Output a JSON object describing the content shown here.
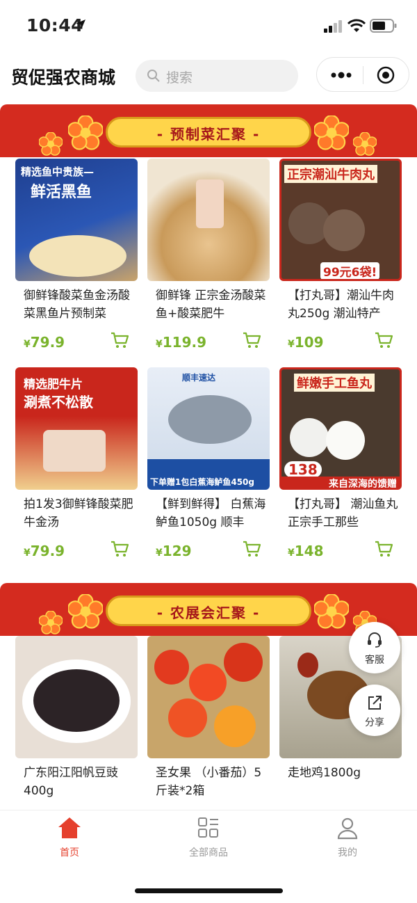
{
  "status_bar": {
    "time": "10:44"
  },
  "header": {
    "title": "贸促强农商城",
    "search_placeholder": "搜索"
  },
  "sections": [
    {
      "title": "- 预制菜汇聚 -"
    },
    {
      "title": "- 农展会汇聚 -"
    }
  ],
  "products_section1": [
    {
      "name": "御鲜锋酸菜鱼金汤酸菜黑鱼片预制菜",
      "price_symbol": "¥",
      "price": "79.9",
      "thumb_text": "精选鱼中贵族—",
      "thumb_text2": "鲜活黑鱼"
    },
    {
      "name": "御鲜锋 正宗金汤酸菜鱼+酸菜肥牛",
      "price_symbol": "¥",
      "price": "119.9"
    },
    {
      "name": "【打丸哥】潮汕牛肉丸250g 潮汕特产",
      "price_symbol": "¥",
      "price": "109",
      "thumb_text": "正宗潮汕牛肉丸",
      "thumb_text2": "99元6袋!"
    },
    {
      "name": "拍1发3御鲜锋酸菜肥牛金汤",
      "price_symbol": "¥",
      "price": "79.9",
      "thumb_text": "精选肥牛片",
      "thumb_text2": "涮煮不松散"
    },
    {
      "name": "【鲜到鲜得】 白蕉海鲈鱼1050g 顺丰",
      "price_symbol": "¥",
      "price": "129",
      "thumb_text": "顺丰速达",
      "thumb_text2": "下单赠1包白蕉海鲈鱼450g"
    },
    {
      "name": "【打丸哥】 潮汕鱼丸正宗手工那些",
      "price_symbol": "¥",
      "price": "148",
      "thumb_text": "鲜嫩手工鱼丸",
      "thumb_text2": "来自深海的馈赠",
      "thumb_badge": "138"
    }
  ],
  "products_section2": [
    {
      "name": "广东阳江阳帆豆豉400g"
    },
    {
      "name": "圣女果 （小番茄）5斤装*2箱"
    },
    {
      "name": "走地鸡1800g"
    }
  ],
  "float_buttons": {
    "service": "客服",
    "share": "分享"
  },
  "tabbar": {
    "home": "首页",
    "all_goods": "全部商品",
    "mine": "我的"
  },
  "colors": {
    "accent": "#e5402d",
    "price": "#7ab32c",
    "banner": "#d42b1f",
    "plate": "#ffd54a"
  },
  "icons": [
    "location-arrow-icon",
    "signal-icon",
    "wifi-icon",
    "battery-icon",
    "search-icon",
    "more-icon",
    "target-icon",
    "cart-icon",
    "flower-icon",
    "headset-icon",
    "share-icon",
    "home-icon",
    "grid-icon",
    "user-icon"
  ]
}
